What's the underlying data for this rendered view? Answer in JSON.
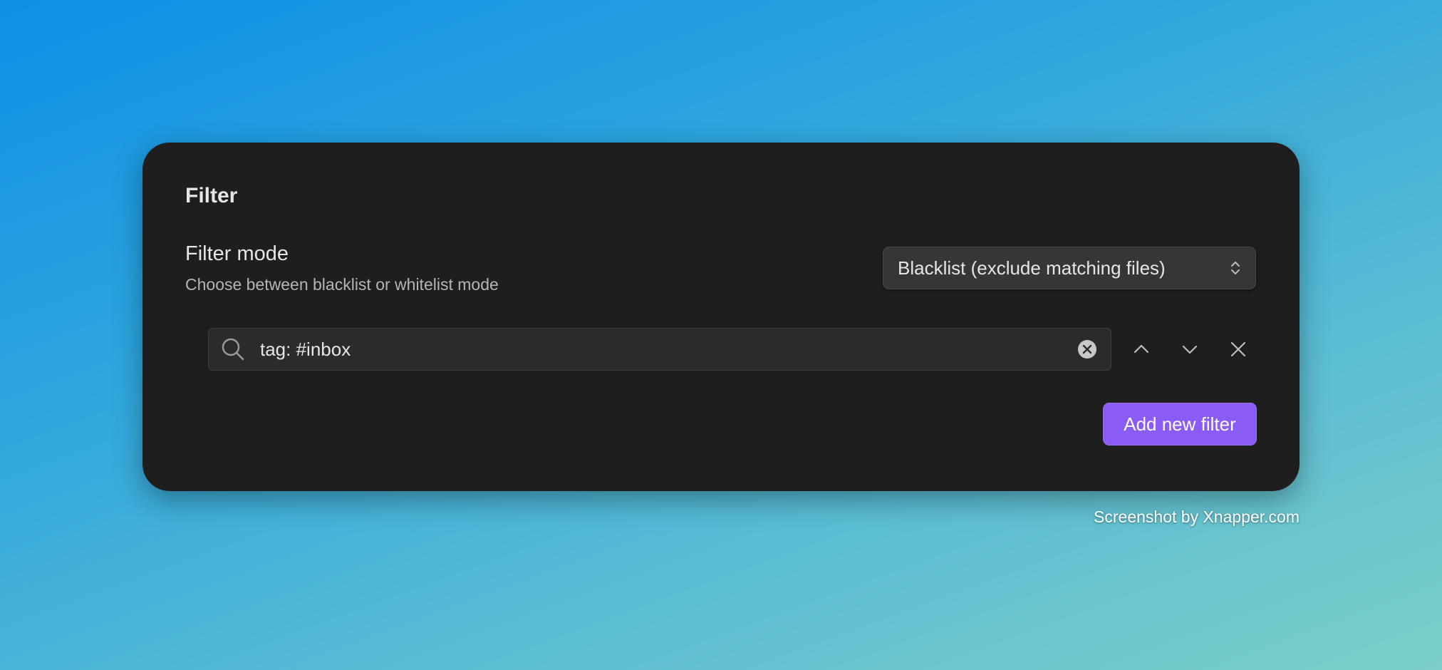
{
  "panel": {
    "title": "Filter",
    "setting": {
      "name": "Filter mode",
      "description": "Choose between blacklist or whitelist mode"
    },
    "mode_select": {
      "selected": "Blacklist (exclude matching files)",
      "icon": "chevron-up-down-icon"
    },
    "filter_row": {
      "query": "tag: #inbox",
      "search_icon": "search-icon",
      "clear_icon": "clear-circle-icon",
      "move_up_icon": "chevron-up-icon",
      "move_down_icon": "chevron-down-icon",
      "remove_icon": "close-icon"
    },
    "add_button_label": "Add new filter"
  },
  "colors": {
    "panel_bg": "#1e1e1e",
    "accent": "#8a5cf5",
    "text_primary": "#e6e6e6",
    "text_muted": "#b5b5b5"
  },
  "credit": "Screenshot by Xnapper.com"
}
